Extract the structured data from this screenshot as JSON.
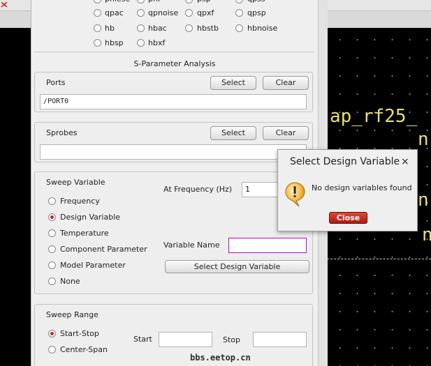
{
  "background": {
    "schematic_text_1": "ap_rf25_",
    "schematic_text_2": "n",
    "schematic_text_3": "n",
    "schematic_text_4": "n"
  },
  "analyses": {
    "row1": [
      "phlese",
      "pnl",
      "psp",
      "qpss"
    ],
    "row2": [
      "qpac",
      "qpnoise",
      "qpxf",
      "qpsp"
    ],
    "row3": [
      "hb",
      "hbac",
      "hbstb",
      "hbnoise"
    ],
    "row4": [
      "hbsp",
      "hbxf"
    ]
  },
  "sp_analysis": {
    "title": "S-Parameter Analysis",
    "ports_label": "Ports",
    "ports_value": "/PORT0",
    "sprobes_label": "Sprobes",
    "sprobes_value": "",
    "select_label": "Select",
    "clear_label": "Clear"
  },
  "sweep_variable": {
    "title": "Sweep Variable",
    "options": [
      "Frequency",
      "Design Variable",
      "Temperature",
      "Component Parameter",
      "Model Parameter",
      "None"
    ],
    "selected": "Design Variable",
    "at_freq_label": "At Frequency (Hz)",
    "at_freq_value": "1",
    "var_name_label": "Variable Name",
    "var_name_value": "",
    "select_design_var_label": "Select Design Variable"
  },
  "sweep_range": {
    "title": "Sweep Range",
    "options": [
      "Start-Stop",
      "Center-Span"
    ],
    "selected": "Start-Stop",
    "start_label": "Start",
    "stop_label": "Stop",
    "start_value": "",
    "stop_value": ""
  },
  "dialog": {
    "title": "Select Design Variable",
    "close_x": "×",
    "message": "No design variables found",
    "close_label": "Close"
  },
  "watermark": "bbs.eetop.cn",
  "colors": {
    "radio_selected": "#c0281c",
    "close_button": "#c9311f",
    "variable_field_border": "#c000c0",
    "schematic_text": "#e8e070"
  }
}
